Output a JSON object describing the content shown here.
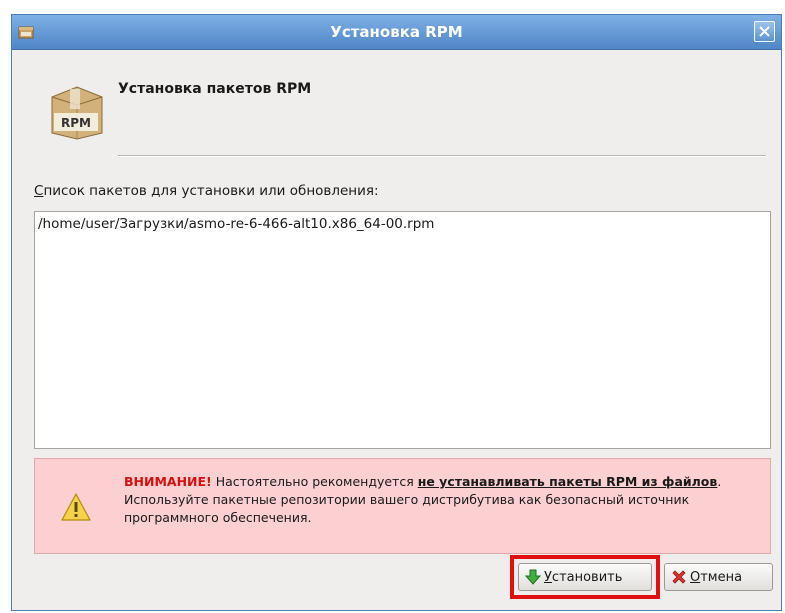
{
  "window": {
    "title": "Установка RPM"
  },
  "header": {
    "icon_text": "RPM",
    "title": "Установка пакетов RPM"
  },
  "list": {
    "label_first_letter": "С",
    "label_rest": "писок пакетов для установки или обновления:",
    "items": [
      "/home/user/Загрузки/asmo-re-6-466-alt10.x86_64-00.rpm"
    ]
  },
  "warning": {
    "strong": "ВНИМАНИЕ!",
    "text_1": " Настоятельно рекомендуется ",
    "emphasis": "не устанавливать пакеты RPM из файлов",
    "text_2": ". Используйте пакетные репозитории вашего дистрибутива как безопасный источник программного обеспечения."
  },
  "buttons": {
    "install_first_letter": "У",
    "install_rest": "становить",
    "cancel_first_letter": "О",
    "cancel_rest": "тмена"
  },
  "colors": {
    "titlebar": "#5a8fd0",
    "warning_bg": "#fcd0d0",
    "highlight": "#e01010"
  }
}
